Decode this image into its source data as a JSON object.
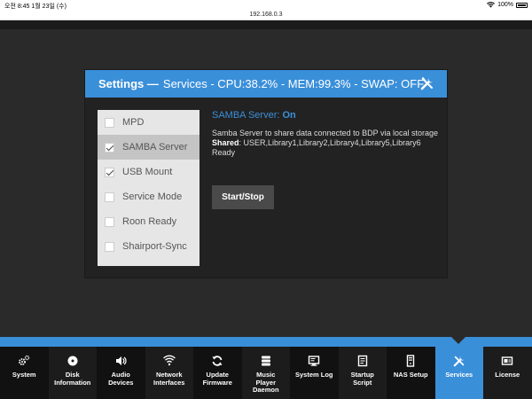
{
  "status_bar": {
    "time": "오전 8:45  1월 23일 (수)",
    "battery": "100%"
  },
  "browser": {
    "url": "192.168.0.3"
  },
  "settings": {
    "title_bold": "Settings —",
    "title_rest": "Services - CPU:38.2% - MEM:99.3% - SWAP: OFF",
    "tools_icon": "tools-icon"
  },
  "services": [
    {
      "label": "MPD",
      "checked": false,
      "active": false
    },
    {
      "label": "SAMBA Server",
      "checked": true,
      "active": true
    },
    {
      "label": "USB Mount",
      "checked": true,
      "active": false
    },
    {
      "label": "Service Mode",
      "checked": false,
      "active": false
    },
    {
      "label": "Roon Ready",
      "checked": false,
      "active": false
    },
    {
      "label": "Shairport-Sync",
      "checked": false,
      "active": false
    }
  ],
  "detail": {
    "name": "SAMBA Server:",
    "state": "On",
    "description": "Samba Server to share data connected to BDP via local storage",
    "shared_label": "Shared",
    "shared_value": ": USER,Library1,Library2,Library4,Library5,Library6",
    "status": "Ready",
    "button": "Start/Stop"
  },
  "nav": [
    {
      "label": "System",
      "icon": "gears-icon"
    },
    {
      "label": "Disk\nInformation",
      "icon": "disk-icon"
    },
    {
      "label": "Audio\nDevices",
      "icon": "speaker-icon"
    },
    {
      "label": "Network\nInterfaces",
      "icon": "wifi-icon"
    },
    {
      "label": "Update\nFirmware",
      "icon": "refresh-icon"
    },
    {
      "label": "Music\nPlayer\nDaemon",
      "icon": "database-icon"
    },
    {
      "label": "System Log",
      "icon": "monitor-icon"
    },
    {
      "label": "Startup\nScript",
      "icon": "script-icon"
    },
    {
      "label": "NAS Setup",
      "icon": "server-icon"
    },
    {
      "label": "Services",
      "icon": "tools-icon"
    },
    {
      "label": "License",
      "icon": "license-icon"
    }
  ],
  "colors": {
    "accent": "#3a8fd9",
    "background": "#2a2a2a",
    "panel": "#222222",
    "navbar": "#111111"
  }
}
